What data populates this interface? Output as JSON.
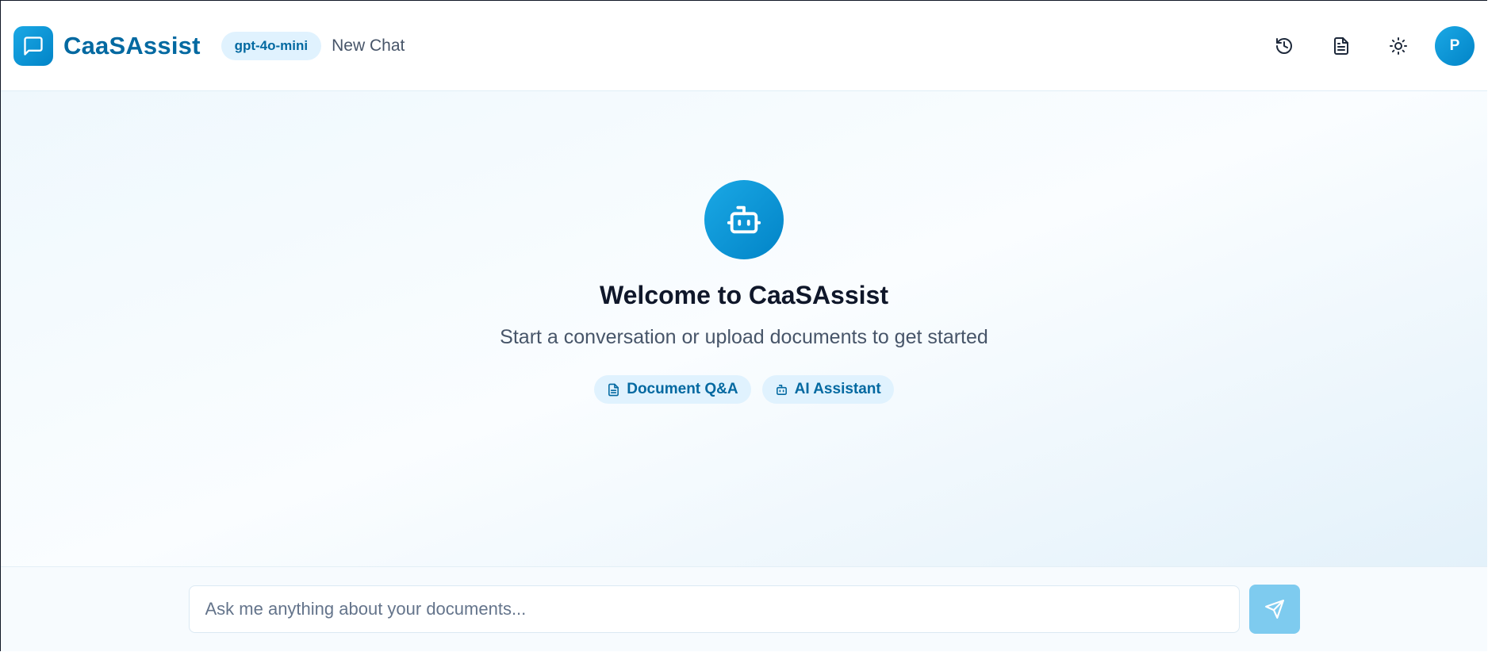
{
  "header": {
    "brand": "CaaSAssist",
    "model_badge": "gpt-4o-mini",
    "chat_title": "New Chat",
    "icons": [
      "history-icon",
      "document-icon",
      "sun-icon"
    ],
    "avatar_initial": "P"
  },
  "main": {
    "welcome_title": "Welcome to CaaSAssist",
    "subtitle": "Start a conversation or upload documents to get started",
    "chips": [
      {
        "label": "Document Q&A",
        "icon": "document-icon"
      },
      {
        "label": "AI Assistant",
        "icon": "bot-icon"
      }
    ]
  },
  "composer": {
    "placeholder": "Ask me anything about your documents...",
    "send_icon": "send-icon"
  },
  "colors": {
    "accent": "#0284c7",
    "brand_text": "#0369a1",
    "chip_bg": "#e0f2fe"
  }
}
